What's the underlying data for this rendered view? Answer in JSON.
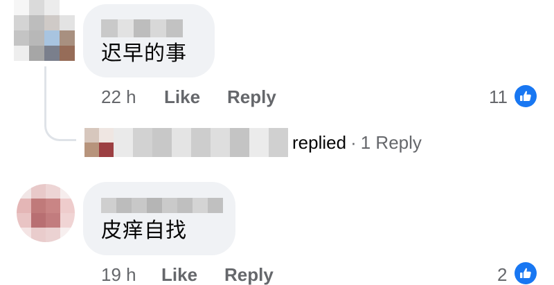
{
  "comments": [
    {
      "text": "迟早的事",
      "time": "22 h",
      "like_label": "Like",
      "reply_label": "Reply",
      "reaction_count": "11",
      "reaction_icon": "thumbs-up-icon"
    },
    {
      "text": "皮痒自找",
      "time": "19 h",
      "like_label": "Like",
      "reply_label": "Reply",
      "reaction_count": "2",
      "reaction_icon": "thumbs-up-icon"
    }
  ],
  "reply_summary": {
    "action": "replied",
    "separator": "·",
    "count_label": "1 Reply"
  },
  "colors": {
    "bubble": "#f0f2f5",
    "meta_text": "#65676b",
    "like_blue": "#1877f2",
    "thread_line": "#dfe3e8"
  }
}
